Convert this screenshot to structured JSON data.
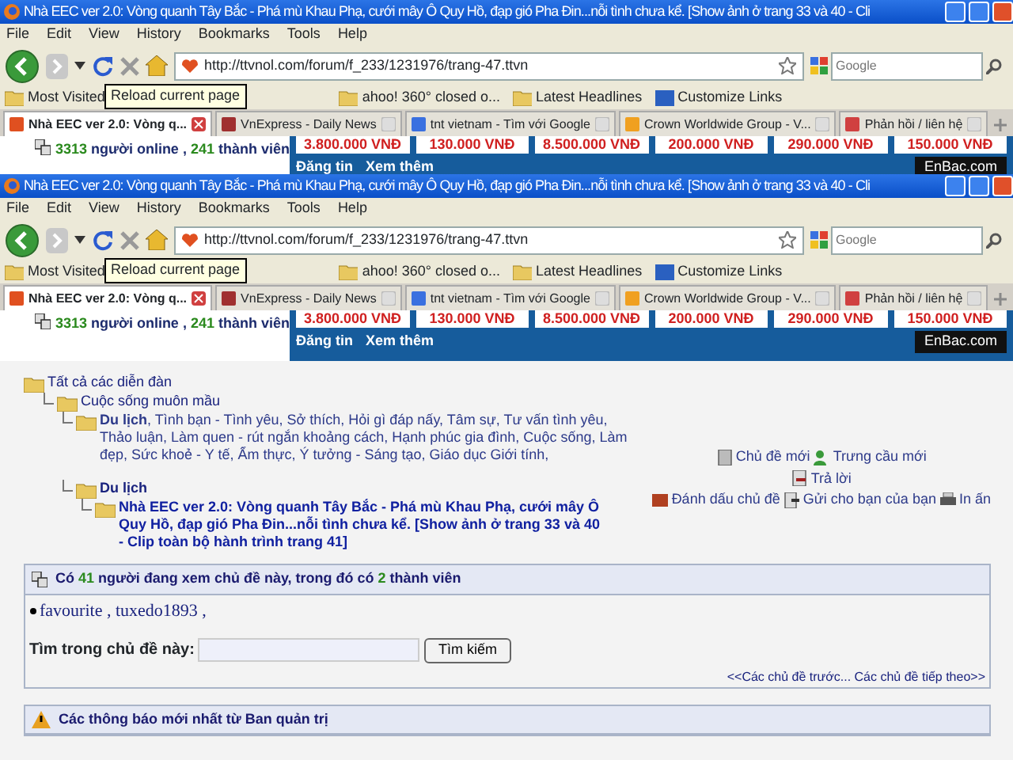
{
  "browser_frames": [
    {
      "window_title": "Nhà EEC ver 2.0: Vòng quanh Tây Bắc - Phá mù Khau Phạ, cưới mây Ô Quy Hồ, đạp gió Pha Đin...nỗi tình chưa kể. [Show ảnh ở trang 33 và 40 - Cli",
      "menu": [
        "File",
        "Edit",
        "View",
        "History",
        "Bookmarks",
        "Tools",
        "Help"
      ],
      "url": "http://ttvnol.com/forum/f_233/1231976/trang-47.ttvn",
      "search_placeholder": "Google",
      "tooltip": "Reload current page",
      "bookmarks": [
        "Most Visited",
        "ahoo! 360° closed o...",
        "Latest Headlines",
        "Customize Links"
      ],
      "tabs": [
        {
          "label": "Nhà EEC ver 2.0: Vòng q...",
          "selected": true
        },
        {
          "label": "VnExpress - Daily News",
          "selected": false
        },
        {
          "label": "tnt vietnam - Tìm với Google",
          "selected": false
        },
        {
          "label": "Crown Worldwide Group - V...",
          "selected": false
        },
        {
          "label": "Phản hồi / liên hệ",
          "selected": false
        }
      ],
      "online": [
        "3313",
        " người online , ",
        "241",
        " thành viên"
      ],
      "prices": [
        "3.800.000 VNĐ",
        "130.000 VNĐ",
        "8.500.000 VNĐ",
        "200.000 VNĐ",
        "290.000 VNĐ",
        "150.000 VNĐ"
      ],
      "ad_links": [
        "Đăng tin",
        "Xem thêm"
      ],
      "ad_brand": "EnBac.com"
    },
    {
      "window_title": "Nhà EEC ver 2.0: Vòng quanh Tây Bắc - Phá mù Khau Phạ, cưới mây Ô Quy Hồ, đạp gió Pha Đin...nỗi tình chưa kể. [Show ảnh ở trang 33 và 40 - Cli",
      "menu": [
        "File",
        "Edit",
        "View",
        "History",
        "Bookmarks",
        "Tools",
        "Help"
      ],
      "url": "http://ttvnol.com/forum/f_233/1231976/trang-47.ttvn",
      "search_placeholder": "Google",
      "tooltip": "Reload current page",
      "bookmarks": [
        "Most Visited",
        "ahoo! 360° closed o...",
        "Latest Headlines",
        "Customize Links"
      ],
      "tabs": [
        {
          "label": "Nhà EEC ver 2.0: Vòng q...",
          "selected": true
        },
        {
          "label": "VnExpress - Daily News",
          "selected": false
        },
        {
          "label": "tnt vietnam - Tìm với Google",
          "selected": false
        },
        {
          "label": "Crown Worldwide Group - V...",
          "selected": false
        },
        {
          "label": "Phản hồi / liên hệ",
          "selected": false
        }
      ],
      "online": [
        "3313",
        " người online , ",
        "241",
        " thành viên"
      ],
      "prices": [
        "3.800.000 VNĐ",
        "130.000 VNĐ",
        "8.500.000 VNĐ",
        "200.000 VNĐ",
        "290.000 VNĐ",
        "150.000 VNĐ"
      ],
      "ad_links": [
        "Đăng tin",
        "Xem thêm"
      ],
      "ad_brand": "EnBac.com"
    }
  ],
  "breadcrumb": {
    "label": "Tất cả các diễn đàn",
    "kind": "forum",
    "children": [
      {
        "label": "Cuộc sống muôn mầu",
        "kind": "forum",
        "children": [
          {
            "label": "**Du lịch**, Tình bạn - Tình yêu, Sở thích, Hỏi gì đáp nấy, Tâm sự, Tư vấn tình yêu, Thảo luận, Làm quen - rút ngắn khoảng cách, Hạnh phúc gia đình, Cuộc sống, Làm đẹp, Sức khoẻ - Y tế, Ẩm thực, Ý tưởng - Sáng tạo, Giáo dục Giới tính,",
            "kind": "forum_list"
          },
          {
            "label": "Du lịch",
            "kind": "current_forum",
            "children": [
              {
                "label": "Nhà EEC ver 2.0: Vòng quanh Tây Bắc - Phá mù Khau Phạ, cưới mây Ô Quy Hồ, đạp gió Pha Đin...nỗi tình chưa kể. [Show ảnh ở trang 33 và 40 - Clip toàn bộ hành trình trang 41]",
                "kind": "thread"
              }
            ]
          }
        ]
      }
    ]
  },
  "actions": [
    [
      "Chủ đề mới",
      "Trưng cầu mới"
    ],
    [
      "Trả lời"
    ],
    [
      "Đánh dấu chủ đề",
      "Gửi cho bạn của bạn",
      "In ấn"
    ]
  ],
  "viewers": {
    "header": [
      "Có ",
      "41",
      " người đang xem chủ đề này, trong đó có ",
      "2",
      " thành viên"
    ],
    "members": "favourite , tuxedo1893 ,",
    "search_label": "Tìm trong chủ đề này:",
    "search_button": "Tìm kiếm",
    "prev_next": "<<Các chủ đề trước... Các chủ đề tiếp theo>>"
  },
  "announcements": {
    "header": "Các thông báo mới nhất từ Ban quản trị"
  }
}
